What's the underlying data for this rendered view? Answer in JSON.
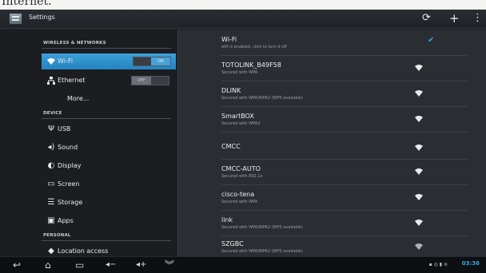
{
  "caption": "Internet.",
  "app": {
    "title": "Settings"
  },
  "actionbar": {
    "icons": [
      "wifi-scan-icon",
      "add-icon",
      "overflow-menu-icon"
    ]
  },
  "left_pane": {
    "section_wireless": "WIRELESS & NETWORKS",
    "section_device": "DEVICE",
    "section_personal": "PERSONAL",
    "items": [
      {
        "label": "Wi-Fi",
        "icon": "wifi-icon",
        "toggle": "ON"
      },
      {
        "label": "Ethernet",
        "icon": "ethernet-icon",
        "toggle": "OFF"
      },
      {
        "label": "More...",
        "icon": ""
      },
      {
        "label": "USB",
        "icon": "usb-icon"
      },
      {
        "label": "Sound",
        "icon": "sound-icon"
      },
      {
        "label": "Display",
        "icon": "display-icon"
      },
      {
        "label": "Screen",
        "icon": "screen-icon"
      },
      {
        "label": "Storage",
        "icon": "storage-icon"
      },
      {
        "label": "Apps",
        "icon": "apps-icon"
      },
      {
        "label": "Location access",
        "icon": "location-icon"
      }
    ]
  },
  "wifi": {
    "header": {
      "name": "Wi-Fi",
      "sub": "wifi is enabled, click to turn it off"
    },
    "networks": [
      {
        "name": "TOTOLINK_B49F58",
        "sub": "Secured with WPA"
      },
      {
        "name": "DLINK",
        "sub": "Secured with WPA/WPA2 (WPS available)"
      },
      {
        "name": "SmartBOX",
        "sub": "Secured with WPA2"
      },
      {
        "name": "CMCC",
        "sub": ""
      },
      {
        "name": "CMCC-AUTO",
        "sub": "Secured with 802.1x"
      },
      {
        "name": "cisco-tena",
        "sub": "Secured with WPA"
      },
      {
        "name": "link",
        "sub": "Secured with WPA/WPA2 (WPS available)"
      },
      {
        "name": "SZGBC",
        "sub": "Secured with WPA/WPA2 (WPS available)"
      }
    ]
  },
  "navbar": {
    "time": "03:36"
  },
  "colors": {
    "accent": "#2384c2",
    "background": "#1b1d21",
    "list_bg": "#2a2d32"
  }
}
